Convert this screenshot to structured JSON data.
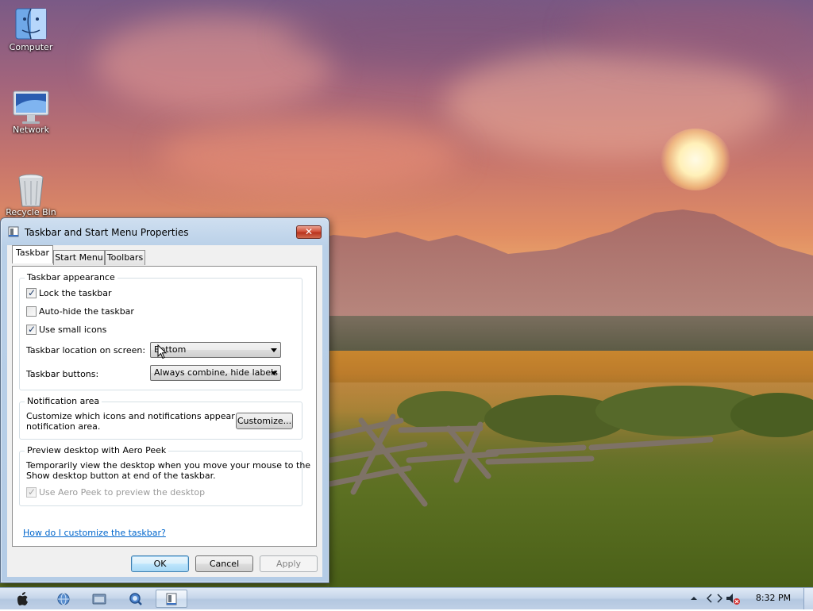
{
  "desktop": {
    "icons": [
      {
        "label": "Computer",
        "icon": "finder-icon"
      },
      {
        "label": "Network",
        "icon": "imac-icon"
      },
      {
        "label": "Recycle Bin",
        "icon": "trash-icon"
      }
    ]
  },
  "dialog": {
    "title": "Taskbar and Start Menu Properties",
    "close_label": "✕",
    "tabs": [
      {
        "label": "Taskbar",
        "active": true
      },
      {
        "label": "Start Menu",
        "active": false
      },
      {
        "label": "Toolbars",
        "active": false
      }
    ],
    "appearance": {
      "title": "Taskbar appearance",
      "lock_label": "Lock the taskbar",
      "lock_checked": true,
      "autohide_label": "Auto-hide the taskbar",
      "autohide_checked": false,
      "small_icons_label": "Use small icons",
      "small_icons_checked": true,
      "location_label": "Taskbar location on screen:",
      "location_value": "Bottom",
      "buttons_label": "Taskbar buttons:",
      "buttons_value": "Always combine, hide labels"
    },
    "notification": {
      "title": "Notification area",
      "text_line1": "Customize which icons and notifications appear in the",
      "text_line2": "notification area.",
      "customize_label": "Customize..."
    },
    "aero_peek": {
      "title": "Preview desktop with Aero Peek",
      "text_line1": "Temporarily view the desktop when you move your mouse to the",
      "text_line2": "Show desktop button at end of the taskbar.",
      "checkbox_label": "Use Aero Peek to preview the desktop",
      "checkbox_checked": true,
      "checkbox_disabled": true
    },
    "help_link": "How do I customize the taskbar?",
    "ok_label": "OK",
    "cancel_label": "Cancel",
    "apply_label": "Apply"
  },
  "taskbar": {
    "items": [
      {
        "icon": "apple-start-icon"
      },
      {
        "icon": "globe-icon"
      },
      {
        "icon": "folder-icon"
      },
      {
        "icon": "search-magnifier-icon"
      },
      {
        "icon": "taskbar-properties-icon",
        "active": true
      }
    ],
    "tray": {
      "clock": "8:32 PM"
    }
  },
  "colors": {
    "link": "#0066cc",
    "close_button": "#c9452e",
    "taskbar": "#c6d6ea"
  }
}
